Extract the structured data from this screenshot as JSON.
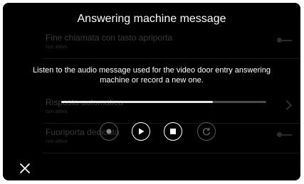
{
  "background_list": {
    "items": [
      {
        "label": "Fine chiamata con tasto apriporta",
        "status": "non attivo",
        "control": "toggle"
      },
      {
        "label": "Risposta automatica",
        "status": "non attivo",
        "control": "chevron"
      },
      {
        "label": "Fuoriporta dedicato",
        "status": "non attivo",
        "control": "toggle"
      }
    ]
  },
  "dialog": {
    "title": "Answering machine message",
    "description": "Listen to the audio message used for the video door entry answering machine or record a new one.",
    "progress": 0.74,
    "controls": {
      "record_icon": "record-icon",
      "play_icon": "play-icon",
      "stop_icon": "stop-icon",
      "reset_icon": "reset-icon"
    },
    "close_icon": "close-icon"
  },
  "colors": {
    "background": "#000000",
    "text": "#ffffff",
    "progress_fill": "#e6e6e6",
    "progress_track": "#4a4a4a",
    "dim_control": "#5a5a5a"
  }
}
